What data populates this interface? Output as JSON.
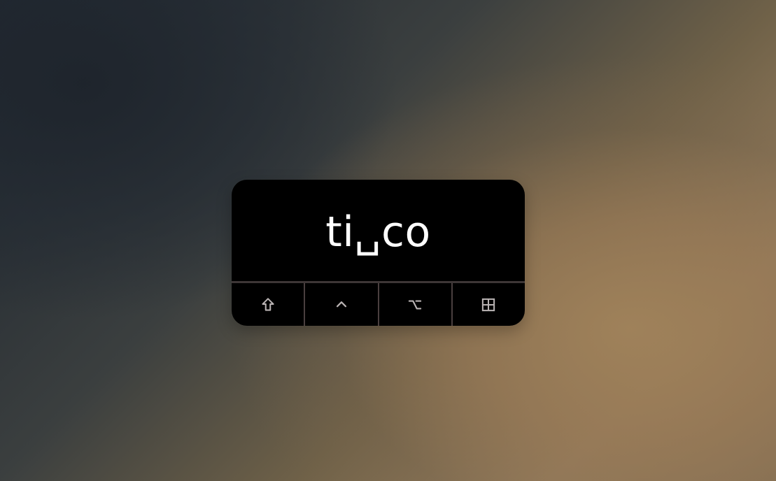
{
  "overlay": {
    "typed_text": "ti␣co",
    "modifiers": [
      {
        "name": "shift",
        "icon": "shift-icon",
        "glyph": "⇧"
      },
      {
        "name": "control",
        "icon": "control-icon",
        "glyph": "^"
      },
      {
        "name": "option",
        "icon": "option-icon",
        "glyph": "⌥"
      },
      {
        "name": "windows",
        "icon": "windows-icon",
        "glyph": "⊞"
      }
    ]
  }
}
